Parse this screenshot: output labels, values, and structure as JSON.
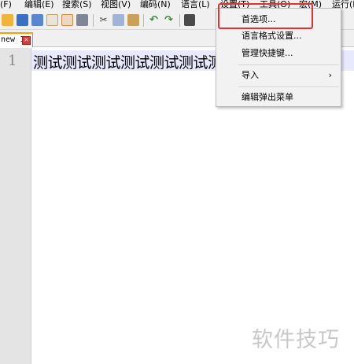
{
  "menubar": {
    "items": [
      "(F)",
      "编辑(E)",
      "搜索(S)",
      "视图(V)",
      "编码(N)",
      "语言(L)",
      "设置(T)",
      "工具(O)",
      "宏(M)",
      "运行(R)"
    ]
  },
  "toolbar": {
    "icons": [
      "open-file-icon",
      "save-icon",
      "save-all-icon",
      "close-icon",
      "close-all-icon",
      "print-icon",
      "cut-icon",
      "copy-icon",
      "paste-icon",
      "undo-icon",
      "redo-icon",
      "find-icon"
    ]
  },
  "tab": {
    "label": "new 1",
    "close_glyph": "✕"
  },
  "editor": {
    "line_number": "1",
    "line_text": "测试测试测试测试测试测试测试",
    "current_line_color": "#e8e8ff"
  },
  "settings_menu": {
    "items": [
      {
        "label": "首选项..."
      },
      {
        "label": "语言格式设置..."
      },
      {
        "label": "管理快捷键..."
      },
      {
        "label": "导入",
        "submenu_arrow": "›"
      },
      {
        "label": "编辑弹出菜单"
      }
    ]
  },
  "watermark": "软件技巧",
  "colors": {
    "highlight": "#e23030",
    "tab_accent": "#f9a000"
  }
}
